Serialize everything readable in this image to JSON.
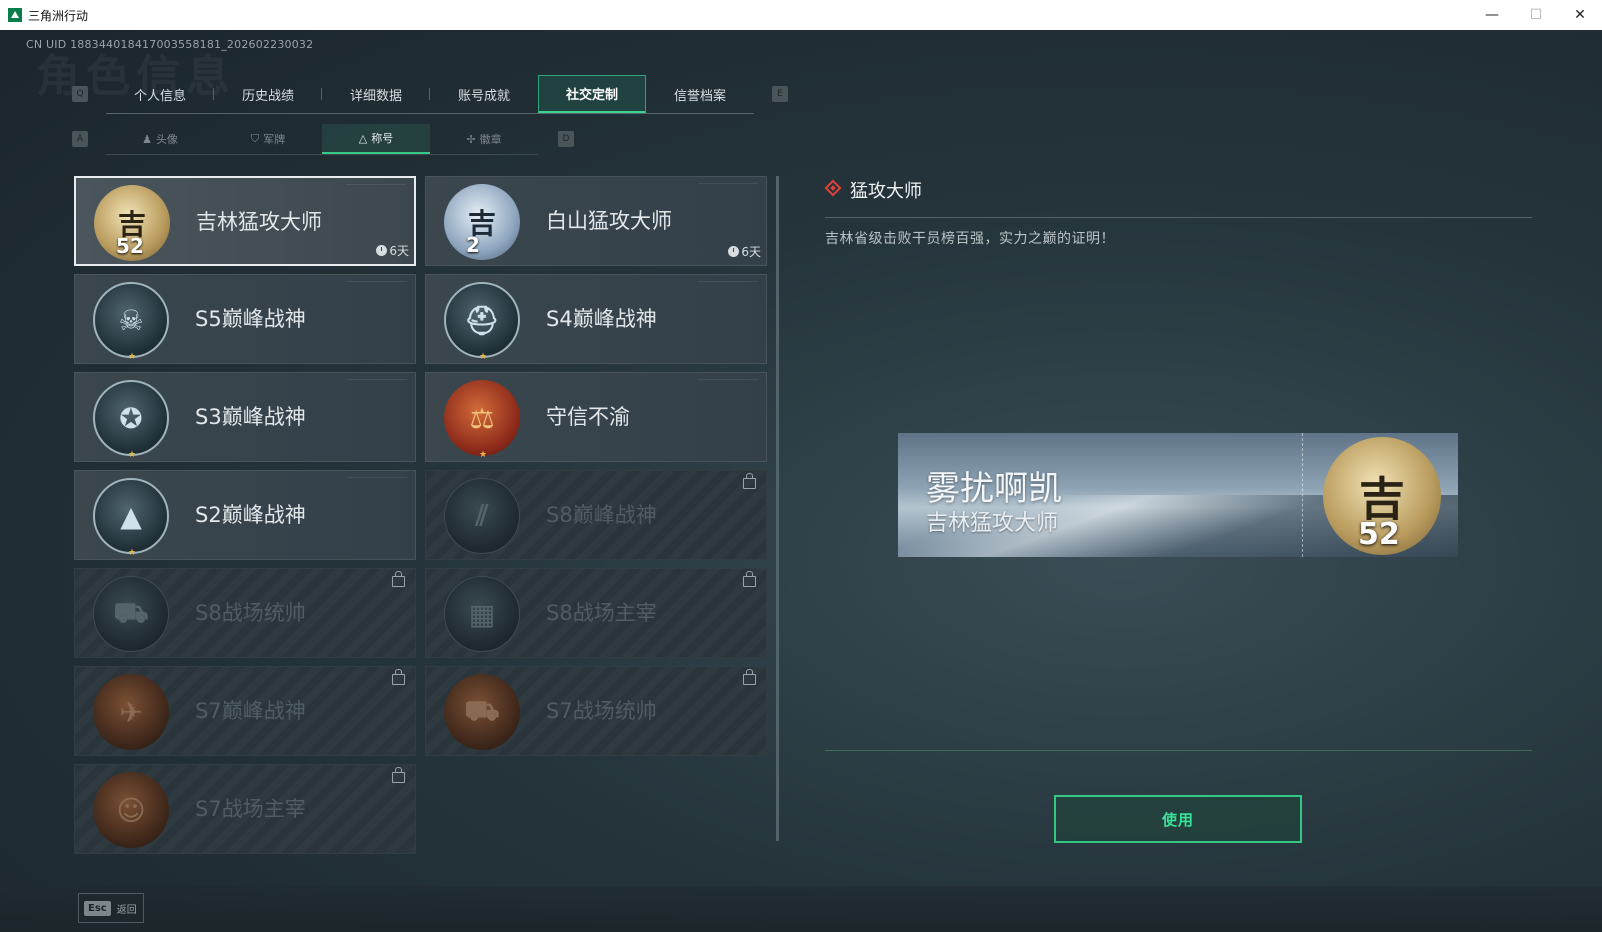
{
  "window": {
    "title": "三角洲行动",
    "min": "—",
    "max": "☐",
    "close": "✕"
  },
  "uid": "CN UID 1883440184170035581​81_202602230032",
  "main_tabs": [
    "个人信息",
    "历史战绩",
    "详细数据",
    "账号成就",
    "社交定制",
    "信誉档案"
  ],
  "main_tab_active": "社交定制",
  "keys": {
    "left_main": "Q",
    "right_main": "E",
    "left_sub": "A",
    "right_sub": "D"
  },
  "sub_tabs": [
    "头像",
    "军牌",
    "称号",
    "徽章"
  ],
  "sub_tab_active": "称号",
  "titles": [
    {
      "name": "吉林猛攻大师",
      "emblem": "吉",
      "number": "52",
      "timer": "6天",
      "locked": false,
      "selected": true
    },
    {
      "name": "白山猛攻大师",
      "emblem": "吉",
      "number": "2",
      "timer": "6天",
      "locked": false,
      "selected": false
    },
    {
      "name": "S5巅峰战神",
      "emblem": "☠",
      "locked": false
    },
    {
      "name": "S4巅峰战神",
      "emblem": "⛑",
      "locked": false
    },
    {
      "name": "S3巅峰战神",
      "emblem": "✪",
      "locked": false
    },
    {
      "name": "守信不渝",
      "emblem": "⚖",
      "locked": false
    },
    {
      "name": "S2巅峰战神",
      "emblem": "▲",
      "locked": false
    },
    {
      "name": "S8巅峰战神",
      "emblem": "⫽",
      "locked": true
    },
    {
      "name": "S8战场统帅",
      "emblem": "⛟",
      "locked": true
    },
    {
      "name": "S8战场主宰",
      "emblem": "▦",
      "locked": true
    },
    {
      "name": "S7巅峰战神",
      "emblem": "✈",
      "locked": true
    },
    {
      "name": "S7战场统帅",
      "emblem": "⛟",
      "locked": true
    },
    {
      "name": "S7战场主宰",
      "emblem": "☺",
      "locked": true
    }
  ],
  "detail": {
    "title": "猛攻大师",
    "description": "吉林省级击败干员榜百强，实力之巅的证明！",
    "nameplate_player": "雾扰啊凯",
    "nameplate_title": "吉林猛攻大师",
    "nameplate_emblem": "吉",
    "nameplate_number": "52"
  },
  "use_button": "使用",
  "footer": {
    "esc_key": "Esc",
    "esc_label": "返回"
  },
  "colors": {
    "accent": "#3ad48f",
    "danger": "#e0413a"
  }
}
